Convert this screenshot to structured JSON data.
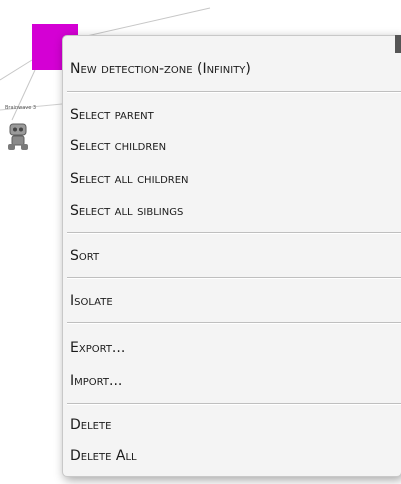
{
  "canvas": {
    "node_label": "Brainwave 3",
    "node_color": "#d400d4"
  },
  "menu": {
    "items": [
      "New detection-zone (Infinity)",
      "Select parent",
      "Select children",
      "Select all children",
      "Select all siblings",
      "Sort",
      "Isolate",
      "Export...",
      "Import...",
      "Delete",
      "Delete All"
    ]
  }
}
